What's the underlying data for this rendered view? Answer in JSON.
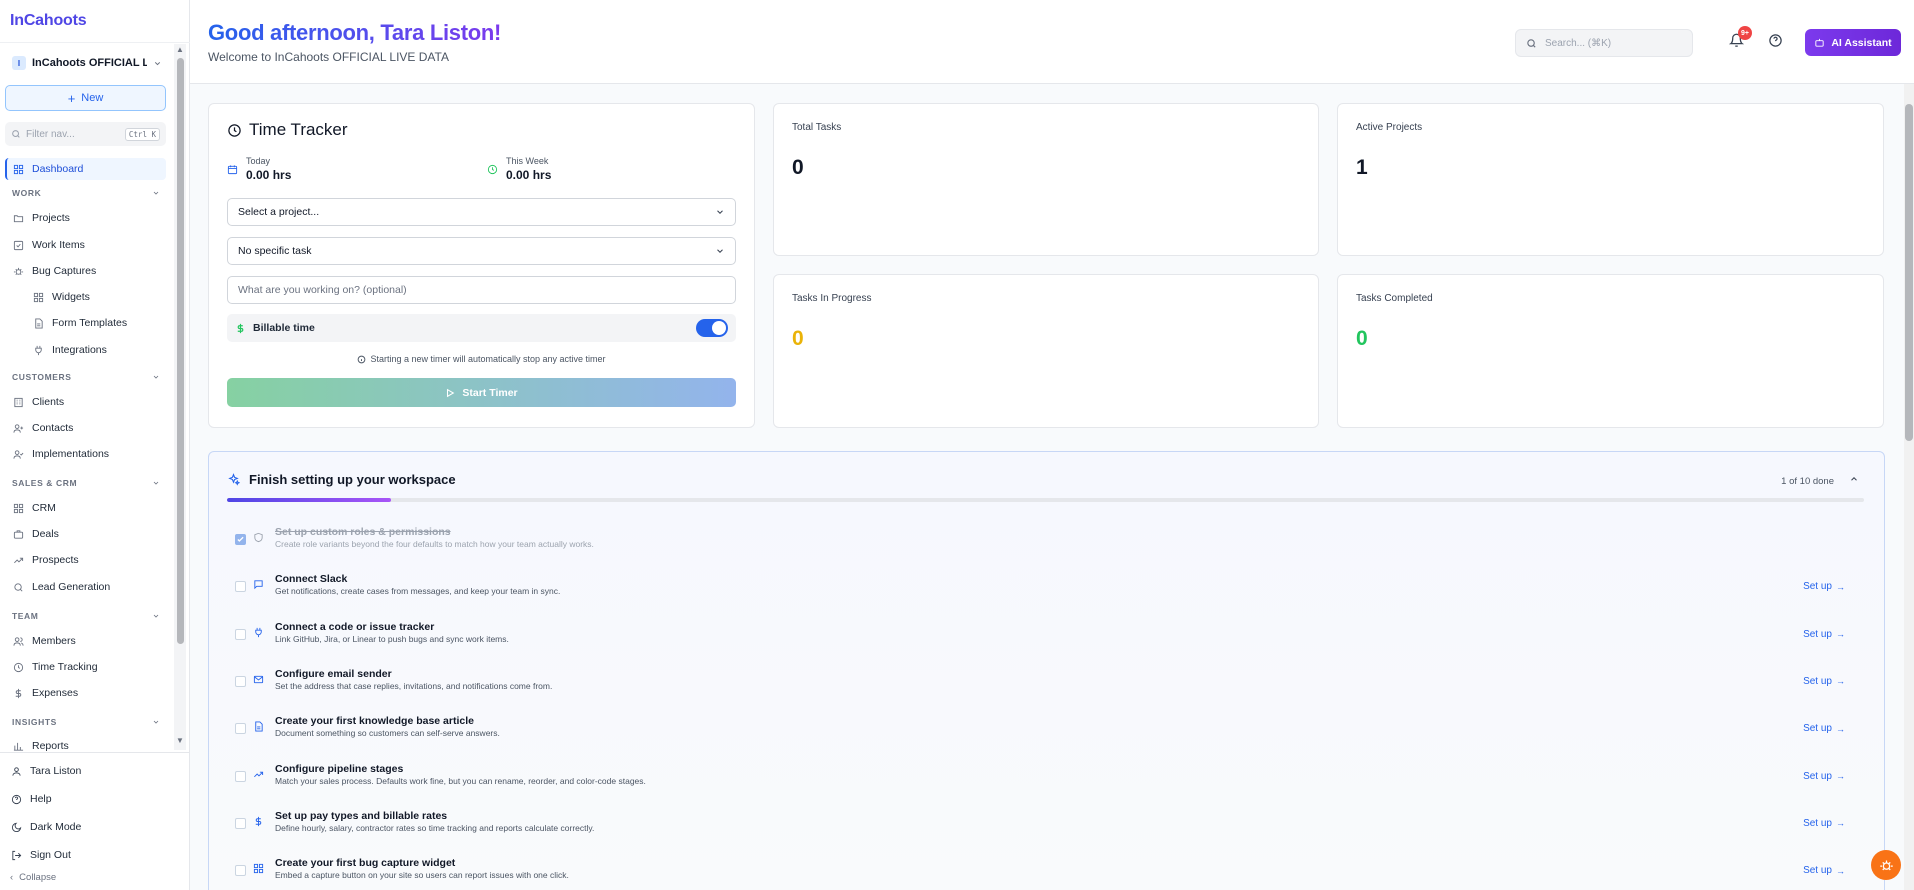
{
  "sidebar": {
    "brand": "InCahoots",
    "workspace_badge": "I",
    "workspace_name": "InCahoots OFFICIAL LI...",
    "new_label": "New",
    "filter_placeholder": "Filter nav...",
    "filter_kbd": "Ctrl K",
    "dashboard": "Dashboard",
    "sections": {
      "work": "WORK",
      "customers": "CUSTOMERS",
      "sales": "SALES & CRM",
      "team": "TEAM",
      "insights": "INSIGHTS"
    },
    "items": {
      "projects": "Projects",
      "work_items": "Work Items",
      "bug_captures": "Bug Captures",
      "widgets": "Widgets",
      "form_templates": "Form Templates",
      "integrations": "Integrations",
      "clients": "Clients",
      "contacts": "Contacts",
      "implementations": "Implementations",
      "crm": "CRM",
      "deals": "Deals",
      "prospects": "Prospects",
      "lead_generation": "Lead Generation",
      "members": "Members",
      "time_tracking": "Time Tracking",
      "expenses": "Expenses",
      "reports": "Reports"
    },
    "footer": {
      "user": "Tara Liston",
      "help": "Help",
      "dark_mode": "Dark Mode",
      "sign_out": "Sign Out",
      "collapse": "Collapse"
    }
  },
  "header": {
    "greeting": "Good afternoon, Tara Liston!",
    "welcome": "Welcome to InCahoots OFFICIAL LIVE DATA",
    "search_placeholder": "Search... (⌘K)",
    "notif_badge": "9+",
    "ai_label": "AI Assistant"
  },
  "time_tracker": {
    "title": "Time Tracker",
    "today_label": "Today",
    "today_value": "0.00 hrs",
    "week_label": "This Week",
    "week_value": "0.00 hrs",
    "project_select": "Select a project...",
    "task_select": "No specific task",
    "note_placeholder": "What are you working on? (optional)",
    "billable_label": "Billable time",
    "billable_on": true,
    "hint": "Starting a new timer will automatically stop any active timer",
    "start_label": "Start Timer"
  },
  "stats": {
    "total_tasks": {
      "label": "Total Tasks",
      "value": "0",
      "color": "#111827"
    },
    "active_projects": {
      "label": "Active Projects",
      "value": "1",
      "color": "#111827"
    },
    "in_progress": {
      "label": "Tasks In Progress",
      "value": "0",
      "color": "#eab308"
    },
    "completed": {
      "label": "Tasks Completed",
      "value": "0",
      "color": "#22c55e"
    }
  },
  "setup": {
    "title": "Finish setting up your workspace",
    "count": "1 of 10 done",
    "progress": 0.1,
    "setup_label": "Set up",
    "tasks": [
      {
        "title": "Set up custom roles & permissions",
        "desc": "Create role variants beyond the four defaults to match how your team actually works.",
        "icon": "shield-icon",
        "done": true
      },
      {
        "title": "Connect Slack",
        "desc": "Get notifications, create cases from messages, and keep your team in sync.",
        "icon": "message-icon",
        "done": false
      },
      {
        "title": "Connect a code or issue tracker",
        "desc": "Link GitHub, Jira, or Linear to push bugs and sync work items.",
        "icon": "plug-icon",
        "done": false
      },
      {
        "title": "Configure email sender",
        "desc": "Set the address that case replies, invitations, and notifications come from.",
        "icon": "mail-icon",
        "done": false
      },
      {
        "title": "Create your first knowledge base article",
        "desc": "Document something so customers can self-serve answers.",
        "icon": "document-icon",
        "done": false
      },
      {
        "title": "Configure pipeline stages",
        "desc": "Match your sales process. Defaults work fine, but you can rename, reorder, and color-code stages.",
        "icon": "trend-icon",
        "done": false
      },
      {
        "title": "Set up pay types and billable rates",
        "desc": "Define hourly, salary, contractor rates so time tracking and reports calculate correctly.",
        "icon": "dollar-icon",
        "done": false
      },
      {
        "title": "Create your first bug capture widget",
        "desc": "Embed a capture button on your site so users can report issues with one click.",
        "icon": "widget-icon",
        "done": false
      }
    ]
  }
}
